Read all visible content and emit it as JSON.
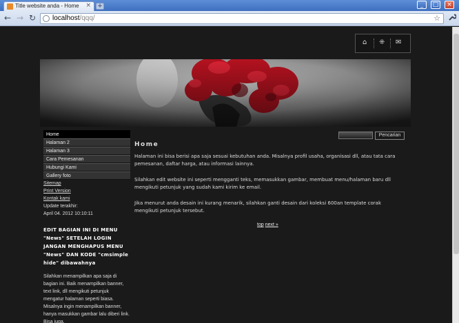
{
  "browser": {
    "tab_title": "Title website anda - Home",
    "tab_close": "×",
    "new_tab": "+",
    "url_host": "localhost",
    "url_path": "/qqq/",
    "win_min": "_",
    "win_max": "□",
    "win_close": "×",
    "back": "←",
    "forward": "→",
    "reload": "↻",
    "star": "☆",
    "wrench": "🔧"
  },
  "top_icons": {
    "home": "⌂",
    "sitemap": "⁜",
    "mail": "✉"
  },
  "sidebar": {
    "menu": [
      {
        "label": "Home",
        "active": true
      },
      {
        "label": "Halaman 2"
      },
      {
        "label": "Halaman 3"
      },
      {
        "label": "Cara Pemesanan"
      },
      {
        "label": "Hubungi Kami"
      },
      {
        "label": "Gallery foto"
      }
    ],
    "sitemap": "Sitemap",
    "print_version": "Print Version",
    "kontak_kami": "Kontak kami",
    "update_label": "Update terakhir:",
    "update_value": "April 04. 2012 10:10:11",
    "edit_heading": "EDIT BAGIAN INI DI MENU \"News\" SETELAH LOGIN JANGAN MENGHAPUS MENU \"News\" DAN KODE \"cmsimple hide\" dibawahnya",
    "paragraph": "Silahkan menampilkan apa saja di bagian ini. Baik menampilkan banner, text link, dll mengikuti petunjuk mengatur halaman seperti biasa. Misalnya ingin menampilkan banner, hanya masukkan gambar lalu diberi link. Bisa juga."
  },
  "search": {
    "button": "Pencarian"
  },
  "main": {
    "title": "Home",
    "para1": "Halaman ini bisa berisi apa saja sesuai kebutuhan anda. Misalnya profil usaha, organisasi dll, atau tata cara pemesanan, daftar harga, atau informasi lainnya.",
    "para2": "Silahkan edit website ini seperti mengganti teks, memasukkan gambar, membuat menu/halaman baru dll mengikuti petunjuk yang sudah kami kirim ke email.",
    "para3": "Jika menurut anda desain ini kurang menarik, silahkan ganti desain dari koleksi 600an template corak mengikuti petunjuk tersebut.",
    "top_link": "top",
    "next_link": "next »"
  },
  "colors": {
    "page_bg": "#1a1a1a",
    "menu_active": "#000000",
    "flower": "#c0192a"
  }
}
